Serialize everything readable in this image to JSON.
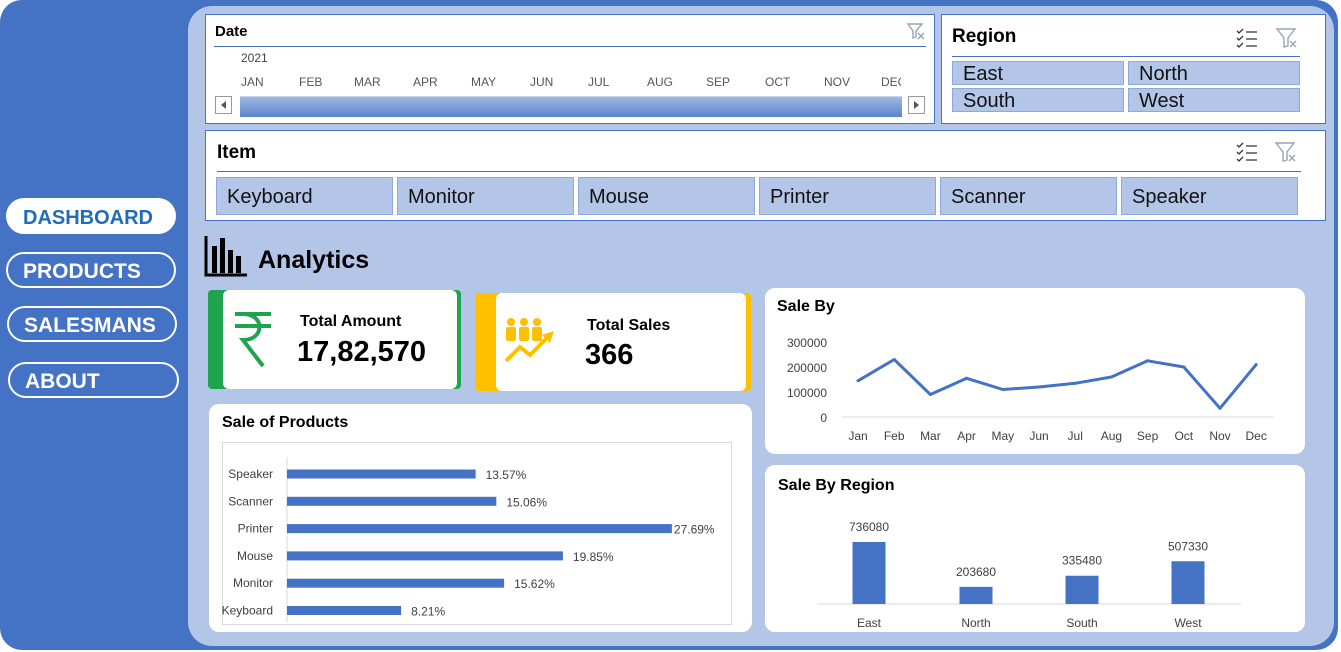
{
  "nav": [
    {
      "label": "DASHBOARD",
      "active": true
    },
    {
      "label": "PRODUCTS",
      "active": false
    },
    {
      "label": "SALESMANS",
      "active": false
    },
    {
      "label": "ABOUT",
      "active": false
    }
  ],
  "date_slicer": {
    "title": "Date",
    "year": "2021",
    "months": [
      "JAN",
      "FEB",
      "MAR",
      "APR",
      "MAY",
      "JUN",
      "JUL",
      "AUG",
      "SEP",
      "OCT",
      "NOV",
      "DEC"
    ]
  },
  "region_slicer": {
    "title": "Region",
    "items": [
      "East",
      "North",
      "South",
      "West"
    ]
  },
  "item_slicer": {
    "title": "Item",
    "items": [
      "Keyboard",
      "Monitor",
      "Mouse",
      "Printer",
      "Scanner",
      "Speaker"
    ]
  },
  "analytics_title": "Analytics",
  "kpis": {
    "total_amount": {
      "label": "Total Amount",
      "value": "17,82,570",
      "accent": "#1ea34f"
    },
    "total_sales": {
      "label": "Total Sales",
      "value": "366",
      "accent": "#ffc000"
    }
  },
  "colors": {
    "series": "#4472c4",
    "nav_bg": "#4472c4",
    "panel_bg": "#b4c6e7"
  },
  "sale_by": {
    "title": "Sale By",
    "chart_data": {
      "type": "line",
      "x": [
        "Jan",
        "Feb",
        "Mar",
        "Apr",
        "May",
        "Jun",
        "Jul",
        "Aug",
        "Sep",
        "Oct",
        "Nov",
        "Dec"
      ],
      "values": [
        145000,
        230000,
        90000,
        155000,
        110000,
        120000,
        135000,
        160000,
        225000,
        200000,
        35000,
        210000
      ],
      "ylim": [
        0,
        300000
      ],
      "yticks": [
        "300000",
        "200000",
        "100000",
        "0"
      ]
    }
  },
  "sale_of_products": {
    "title": "Sale of Products",
    "chart_data": {
      "type": "bar",
      "categories": [
        "Speaker",
        "Scanner",
        "Printer",
        "Mouse",
        "Monitor",
        "Keyboard"
      ],
      "values": [
        13.57,
        15.06,
        27.69,
        19.85,
        15.62,
        8.21
      ],
      "labels": [
        "13.57%",
        "15.06%",
        "27.69%",
        "19.85%",
        "15.62%",
        "8.21%"
      ]
    }
  },
  "sale_by_region": {
    "title": "Sale By Region",
    "chart_data": {
      "type": "bar",
      "categories": [
        "East",
        "North",
        "South",
        "West"
      ],
      "values": [
        736080,
        203680,
        335480,
        507330
      ],
      "labels": [
        "736080",
        "203680",
        "335480",
        "507330"
      ]
    }
  }
}
